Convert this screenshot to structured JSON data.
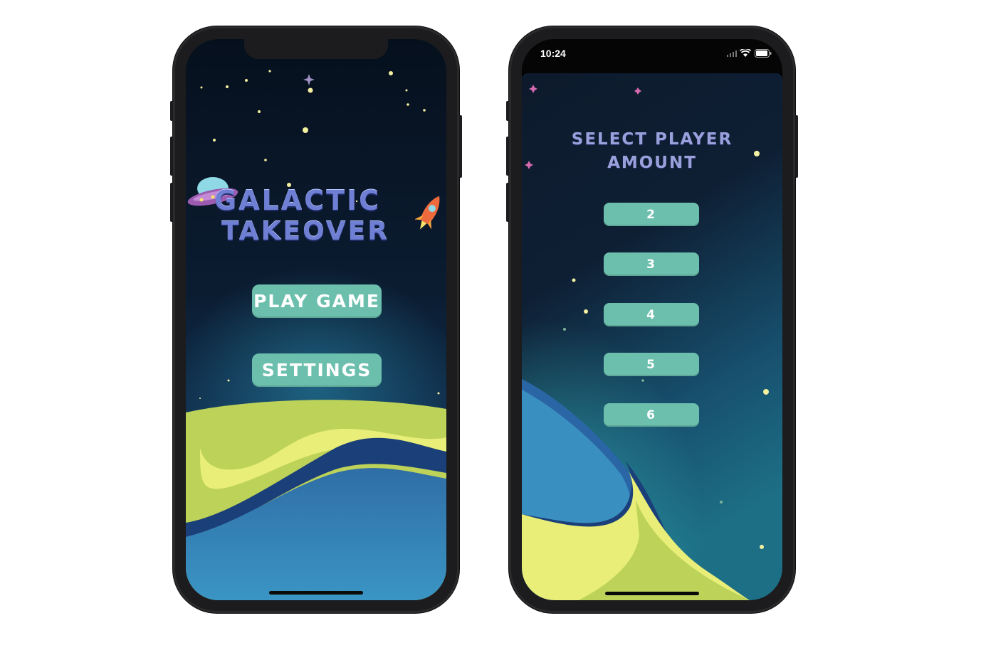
{
  "colors": {
    "accent_button": "#6cbfad",
    "planet_yellow": "#e8ee7a",
    "planet_green": "#bdd35a",
    "planet_blue": "#3a8fc1",
    "sky_dark": "#0b1c31"
  },
  "home_screen": {
    "logo": {
      "line1": "GALACTIC",
      "line2": "TAKEOVER"
    },
    "play_button": "PLAY GAME",
    "settings_button": "SETTINGS"
  },
  "player_select_screen": {
    "status_bar": {
      "time": "10:24"
    },
    "title_line1": "SELECT PLAYER",
    "title_line2": "AMOUNT",
    "options": [
      "2",
      "3",
      "4",
      "5",
      "6"
    ]
  },
  "icons": [
    "ufo-icon",
    "rocket-icon",
    "wifi-icon",
    "battery-icon",
    "signal-icon"
  ]
}
